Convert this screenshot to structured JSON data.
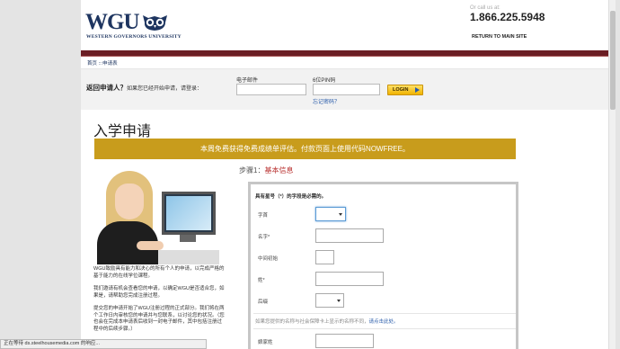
{
  "header": {
    "logo_text": "WGU",
    "logo_subtitle": "WESTERN GOVERNORS UNIVERSITY",
    "call_label": "Or call us at:",
    "phone": "1.866.225.5948",
    "return_link": "RETURN TO MAIN SITE"
  },
  "breadcrumb": "首页  :::申请表",
  "login": {
    "heading": "返回申请人？",
    "prompt": "如果您已经开始申请，请登录：",
    "email_label": "电子邮件",
    "email_value": "",
    "pin_label": "6位PIN码",
    "pin_value": "",
    "forgot_link": "忘记密码？",
    "login_button": "LOGIN"
  },
  "page_title": "入学申请",
  "banner_text": "本周免费获得免费成绩单评估。付款页面上使用代码NOWFREE。",
  "left_text": {
    "p1": "WGU致励具有能力和决心的所有个人的申请，以完成严格的基于能力的在线学位课程。",
    "p2": "我们邀请有机会查看您的申请，以确定WGU是否适合您，如果是，请帮助您完成注册过程。",
    "p3": "提交您的申请开始了WGU注册过程的正式部分。我们将在两个工作日内审核您的申请并与您联系，以讨论您的状况。（您也会在完成本申请表后收到一封电子邮件，其中包括注册过程中的后续步骤。）"
  },
  "step": {
    "prefix": "步骤1：",
    "name": "基本信息"
  },
  "form": {
    "required_note": "具有星号（*）的字段是必需的。",
    "fields": [
      {
        "label": "字首",
        "value": ""
      },
      {
        "label": "名字*",
        "value": ""
      },
      {
        "label": "中间初始",
        "value": ""
      },
      {
        "label": "姓*",
        "value": ""
      },
      {
        "label": "后缀",
        "value": ""
      },
      {
        "label": "娘家姓",
        "value": ""
      }
    ],
    "id_note": "如果您提供的名称与社会保障卡上显示的名称不同，",
    "id_note_link": "请点击此处。"
  },
  "status_bar": "正在等待 ds.steelhousemedia.com 的响应..."
}
